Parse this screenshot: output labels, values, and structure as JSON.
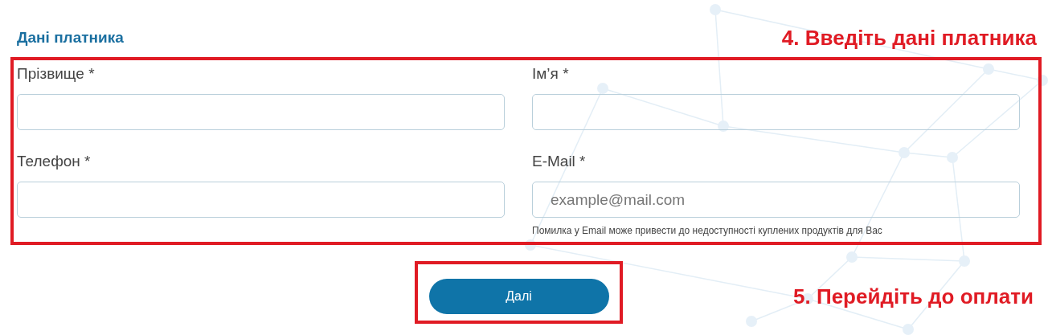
{
  "section_title": "Дані платника",
  "annotations": [
    {
      "text": "4. Введіть дані платника"
    },
    {
      "text": "5. Перейдіть до оплати"
    }
  ],
  "fields": [
    {
      "label": "Прізвище *"
    },
    {
      "label": "Ім’я *"
    },
    {
      "label": "Телефон *"
    },
    {
      "label": "E-Mail *",
      "placeholder": "example@mail.com",
      "hint": "Помилка у Email може привести до недоступності куплених продуктів для Вас"
    }
  ],
  "submit_button": {
    "label": "Далі"
  }
}
